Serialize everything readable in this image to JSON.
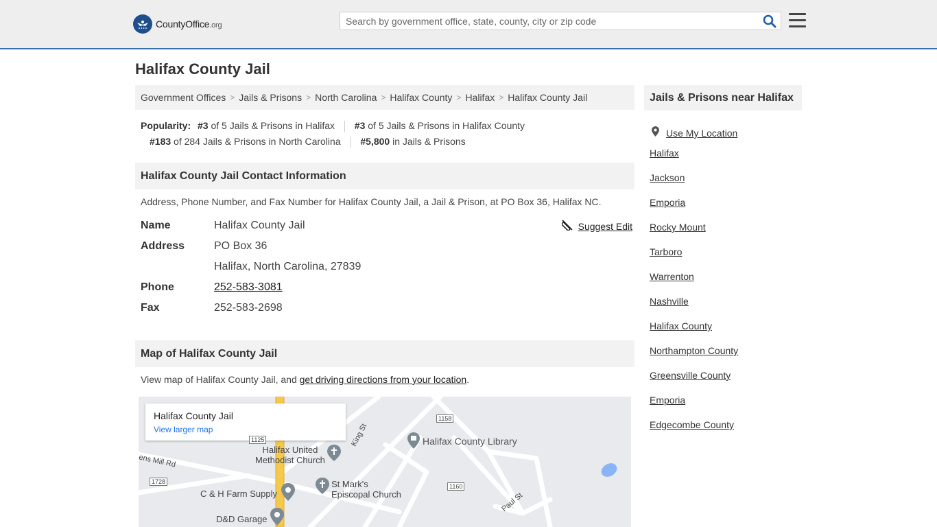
{
  "header": {
    "logo_main": "CountyOffice",
    "logo_suffix": ".org",
    "search_placeholder": "Search by government office, state, county, city or zip code"
  },
  "page_title": "Halifax County Jail",
  "breadcrumb": [
    "Government Offices",
    "Jails & Prisons",
    "North Carolina",
    "Halifax County",
    "Halifax",
    "Halifax County Jail"
  ],
  "popularity": {
    "label": "Popularity:",
    "items": [
      {
        "rank": "#3",
        "text": "of 5 Jails & Prisons in Halifax"
      },
      {
        "rank": "#3",
        "text": "of 5 Jails & Prisons in Halifax County"
      },
      {
        "rank": "#183",
        "text": "of 284 Jails & Prisons in North Carolina"
      },
      {
        "rank": "#5,800",
        "text": "in Jails & Prisons"
      }
    ]
  },
  "contact": {
    "heading": "Halifax County Jail Contact Information",
    "description": "Address, Phone Number, and Fax Number for Halifax County Jail, a Jail & Prison, at PO Box 36, Halifax NC.",
    "suggest_edit": "Suggest Edit",
    "name_label": "Name",
    "name": "Halifax County Jail",
    "address_label": "Address",
    "address_line1": "PO Box 36",
    "address_line2": "Halifax, North Carolina, 27839",
    "phone_label": "Phone",
    "phone": "252-583-3081",
    "fax_label": "Fax",
    "fax": "252-583-2698"
  },
  "map": {
    "heading": "Map of Halifax County Jail",
    "desc_prefix": "View map of Halifax County Jail, and ",
    "desc_link": "get driving directions from your location",
    "desc_suffix": ".",
    "card_title": "Halifax County Jail",
    "card_link": "View larger map",
    "labels": {
      "library": "Halifax County Library",
      "methodist_1": "Halifax United",
      "methodist_2": "Methodist Church",
      "stmarks_1": "St Mark's",
      "stmarks_2": "Episcopal Church",
      "farm": "C & H Farm Supply",
      "garage": "D&D Garage",
      "king_st": "King St",
      "paul_st": "Paul St",
      "mill_rd": "ens Mill Rd",
      "r1158": "1158",
      "r1160": "1160",
      "r1728": "1728",
      "r1125": "1125"
    }
  },
  "sidebar": {
    "heading": "Jails & Prisons near Halifax",
    "use_location": "Use My Location",
    "items": [
      "Halifax",
      "Jackson",
      "Emporia",
      "Rocky Mount",
      "Tarboro",
      "Warrenton",
      "Nashville",
      "Halifax County",
      "Northampton County",
      "Greensville County",
      "Emporia",
      "Edgecombe County"
    ]
  },
  "colors": {
    "accent": "#3a6fb0",
    "search_icon": "#1f5fa8",
    "road_yellow": "#f5c94a",
    "water": "#8ab4f8"
  }
}
